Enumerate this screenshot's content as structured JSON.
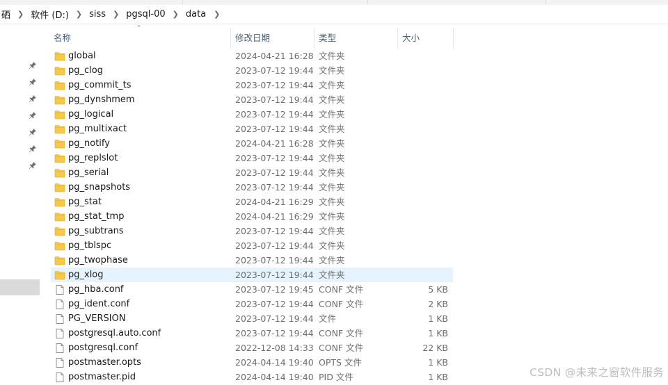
{
  "address": {
    "crumbs": [
      "硒",
      "软件 (D:)",
      "siss",
      "pgsql-00",
      "data"
    ]
  },
  "columns": {
    "name": "名称",
    "date": "修改日期",
    "type": "类型",
    "size": "大小"
  },
  "files": [
    {
      "name": "global",
      "date": "2024-04-21 16:28",
      "type": "文件夹",
      "size": "",
      "kind": "folder"
    },
    {
      "name": "pg_clog",
      "date": "2023-07-12 19:44",
      "type": "文件夹",
      "size": "",
      "kind": "folder"
    },
    {
      "name": "pg_commit_ts",
      "date": "2023-07-12 19:44",
      "type": "文件夹",
      "size": "",
      "kind": "folder"
    },
    {
      "name": "pg_dynshmem",
      "date": "2023-07-12 19:44",
      "type": "文件夹",
      "size": "",
      "kind": "folder"
    },
    {
      "name": "pg_logical",
      "date": "2023-07-12 19:44",
      "type": "文件夹",
      "size": "",
      "kind": "folder"
    },
    {
      "name": "pg_multixact",
      "date": "2023-07-12 19:44",
      "type": "文件夹",
      "size": "",
      "kind": "folder"
    },
    {
      "name": "pg_notify",
      "date": "2024-04-21 16:28",
      "type": "文件夹",
      "size": "",
      "kind": "folder"
    },
    {
      "name": "pg_replslot",
      "date": "2023-07-12 19:44",
      "type": "文件夹",
      "size": "",
      "kind": "folder"
    },
    {
      "name": "pg_serial",
      "date": "2023-07-12 19:44",
      "type": "文件夹",
      "size": "",
      "kind": "folder"
    },
    {
      "name": "pg_snapshots",
      "date": "2023-07-12 19:44",
      "type": "文件夹",
      "size": "",
      "kind": "folder"
    },
    {
      "name": "pg_stat",
      "date": "2024-04-21 16:29",
      "type": "文件夹",
      "size": "",
      "kind": "folder"
    },
    {
      "name": "pg_stat_tmp",
      "date": "2024-04-21 16:29",
      "type": "文件夹",
      "size": "",
      "kind": "folder"
    },
    {
      "name": "pg_subtrans",
      "date": "2023-07-12 19:44",
      "type": "文件夹",
      "size": "",
      "kind": "folder"
    },
    {
      "name": "pg_tblspc",
      "date": "2023-07-12 19:44",
      "type": "文件夹",
      "size": "",
      "kind": "folder"
    },
    {
      "name": "pg_twophase",
      "date": "2023-07-12 19:44",
      "type": "文件夹",
      "size": "",
      "kind": "folder"
    },
    {
      "name": "pg_xlog",
      "date": "2023-07-12 19:44",
      "type": "文件夹",
      "size": "",
      "kind": "folder",
      "selected": true
    },
    {
      "name": "pg_hba.conf",
      "date": "2023-07-12 19:45",
      "type": "CONF 文件",
      "size": "5 KB",
      "kind": "file"
    },
    {
      "name": "pg_ident.conf",
      "date": "2023-07-12 19:44",
      "type": "CONF 文件",
      "size": "2 KB",
      "kind": "file"
    },
    {
      "name": "PG_VERSION",
      "date": "2023-07-12 19:44",
      "type": "文件",
      "size": "1 KB",
      "kind": "file"
    },
    {
      "name": "postgresql.auto.conf",
      "date": "2023-07-12 19:44",
      "type": "CONF 文件",
      "size": "1 KB",
      "kind": "file"
    },
    {
      "name": "postgresql.conf",
      "date": "2022-12-08 14:33",
      "type": "CONF 文件",
      "size": "22 KB",
      "kind": "file"
    },
    {
      "name": "postmaster.opts",
      "date": "2024-04-14 19:40",
      "type": "OPTS 文件",
      "size": "1 KB",
      "kind": "file"
    },
    {
      "name": "postmaster.pid",
      "date": "2024-04-14 19:40",
      "type": "PID 文件",
      "size": "1 KB",
      "kind": "file"
    }
  ],
  "watermark": "CSDN @未来之窗软件服务",
  "colors": {
    "folder": "#f7c948",
    "selected_row": "#e5f3ff",
    "header_text": "#4c607a"
  }
}
